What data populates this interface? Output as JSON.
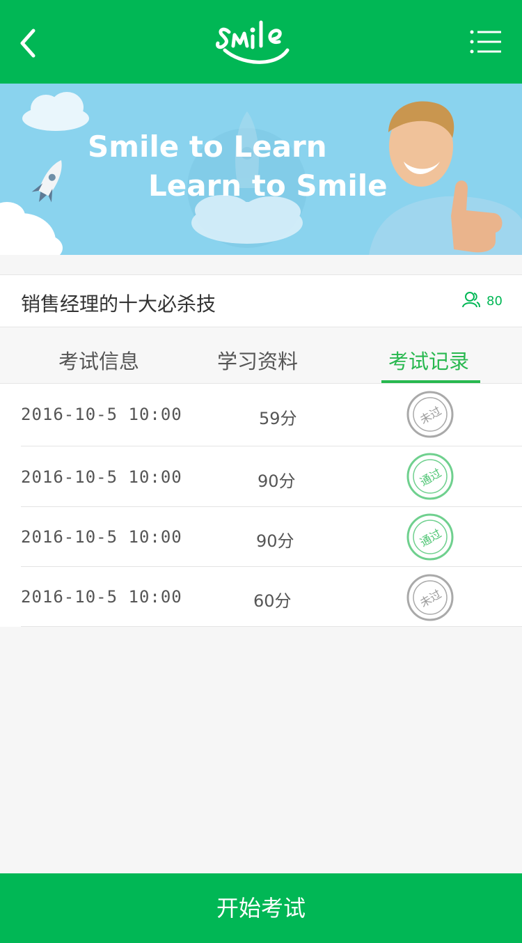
{
  "header": {
    "logo_text": "smile",
    "brand_color": "#01b755"
  },
  "banner": {
    "line1": "Smile to Learn",
    "line2": "Learn  to Smile"
  },
  "course": {
    "title": "销售经理的十大必杀技",
    "participants": "80"
  },
  "tabs": [
    {
      "label": "考试信息",
      "active": false
    },
    {
      "label": "学习资料",
      "active": false
    },
    {
      "label": "考试记录",
      "active": true
    }
  ],
  "records": [
    {
      "date": "2016-10-5 10:00",
      "score": "59分",
      "status": "未过",
      "passed": false
    },
    {
      "date": "2016-10-5 10:00",
      "score": "90分",
      "status": "通过",
      "passed": true
    },
    {
      "date": "2016-10-5 10:00",
      "score": "90分",
      "status": "通过",
      "passed": true
    },
    {
      "date": "2016-10-5 10:00",
      "score": "60分",
      "status": "未过",
      "passed": false
    }
  ],
  "footer": {
    "start_label": "开始考试"
  }
}
